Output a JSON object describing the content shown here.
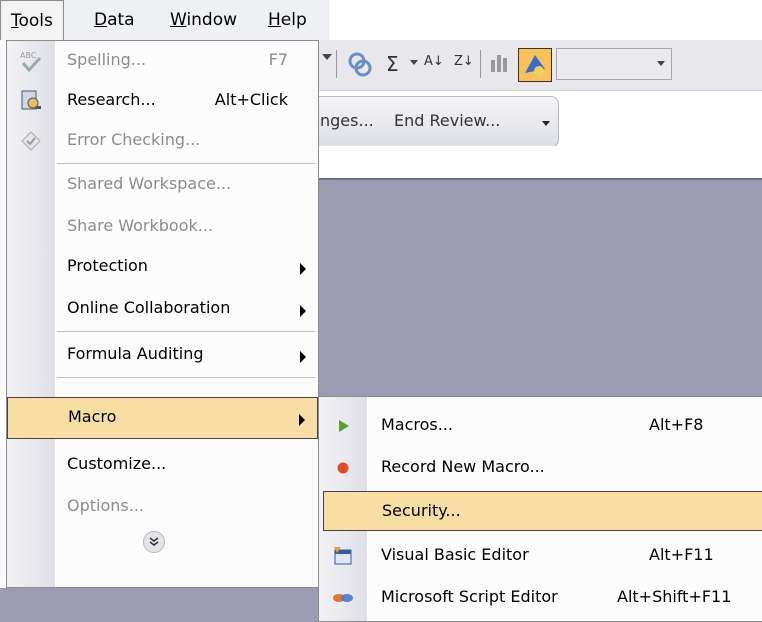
{
  "menubar": {
    "items": [
      {
        "label": "Tools",
        "u": "T",
        "rest": "ools"
      },
      {
        "label": "Data",
        "u": "D",
        "rest": "ata"
      },
      {
        "label": "Window",
        "u": "W",
        "rest": "indow"
      },
      {
        "label": "Help",
        "u": "H",
        "rest": "elp"
      }
    ]
  },
  "toolbar": {
    "sigma": "Σ",
    "sort_asc": "A↓",
    "sort_desc": "Z↓",
    "review": {
      "changes_label": "nges...",
      "end_review_label": "End Review..."
    }
  },
  "tools_menu": {
    "spelling": {
      "label": "Spelling...",
      "shortcut": "F7"
    },
    "research": {
      "label": "Research...",
      "shortcut": "Alt+Click"
    },
    "error_checking": {
      "label": "Error Checking..."
    },
    "shared_workspace": {
      "label": "Shared Workspace..."
    },
    "share_workbook": {
      "label": "Share Workbook..."
    },
    "protection": {
      "label": "Protection"
    },
    "online_collaboration": {
      "label": "Online Collaboration"
    },
    "formula_auditing": {
      "label": "Formula Auditing"
    },
    "macro": {
      "label": "Macro"
    },
    "customize": {
      "label": "Customize..."
    },
    "options": {
      "label": "Options..."
    }
  },
  "macro_menu": {
    "macros": {
      "label": "Macros...",
      "shortcut": "Alt+F8"
    },
    "record": {
      "label": "Record New Macro..."
    },
    "security": {
      "label": "Security..."
    },
    "vbe": {
      "label": "Visual Basic Editor",
      "shortcut": "Alt+F11"
    },
    "script_editor": {
      "label": "Microsoft Script Editor",
      "shortcut": "Alt+Shift+F11"
    }
  },
  "colors": {
    "highlight": "#f8dea4",
    "workspace": "#9c9db3",
    "menu_bg": "#fcfcfc"
  }
}
